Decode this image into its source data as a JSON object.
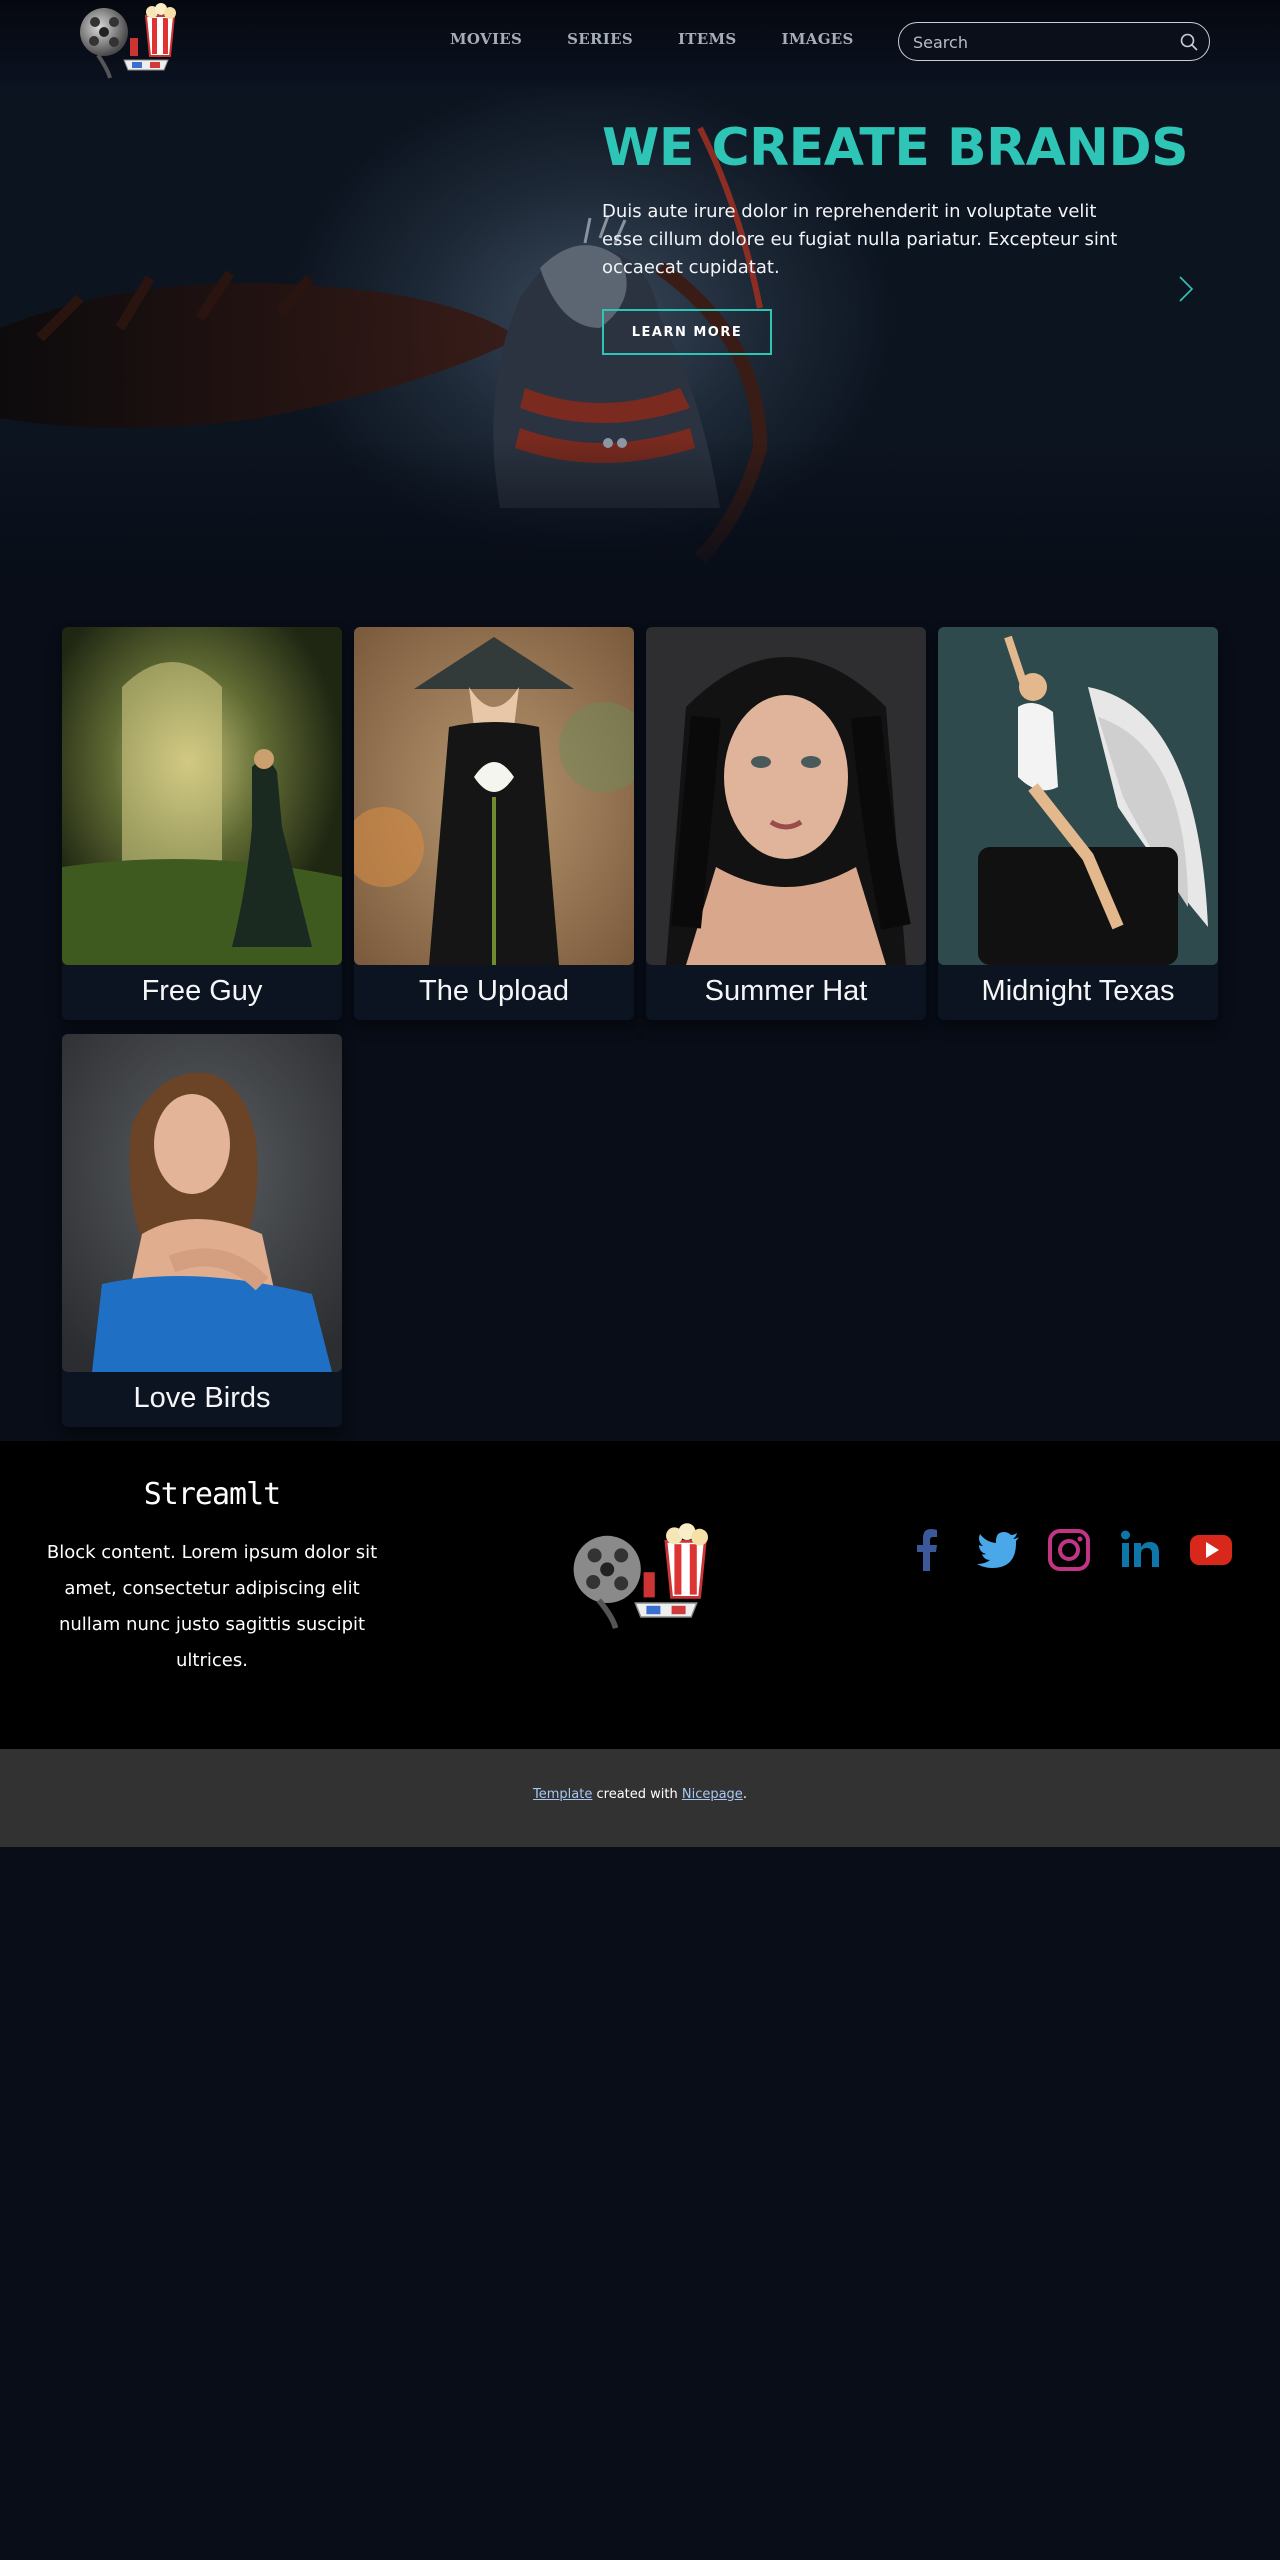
{
  "header": {
    "nav": [
      "MOVIES",
      "SERIES",
      "ITEMS",
      "IMAGES"
    ],
    "search_placeholder": "Search"
  },
  "hero": {
    "title": "WE CREATE BRANDS",
    "text": "Duis aute irure dolor in reprehenderit in voluptate velit esse cillum dolore eu fugiat nulla pariatur. Excepteur sint occaecat cupidatat.",
    "button_label": "learn more",
    "accent_color": "#2ec4b6",
    "slide_count": 2
  },
  "cards": [
    {
      "title": "Free Guy"
    },
    {
      "title": "The Upload"
    },
    {
      "title": "Summer Hat"
    },
    {
      "title": "Midnight Texas"
    },
    {
      "title": "Love Birds"
    }
  ],
  "footer": {
    "brand": "Streamlt",
    "text": "Block content. Lorem ipsum dolor sit amet, consectetur adipiscing elit nullam nunc justo sagittis suscipit ultrices.",
    "socials": [
      "facebook-icon",
      "twitter-icon",
      "instagram-icon",
      "linkedin-icon",
      "youtube-icon"
    ],
    "credits": {
      "template_link": "Template",
      "middle": " created with ",
      "nicepage_link": "Nicepage",
      "end": "."
    }
  }
}
